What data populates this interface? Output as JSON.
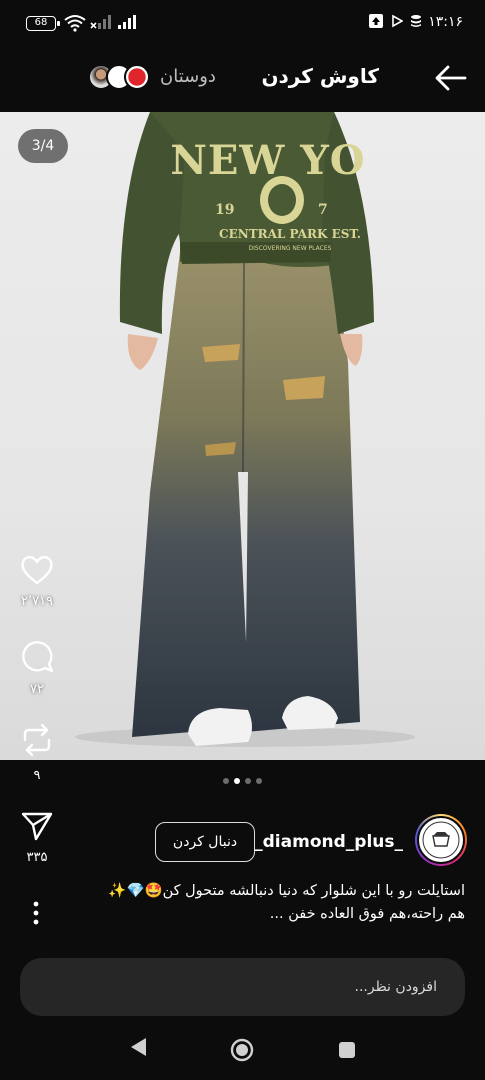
{
  "status_bar": {
    "battery": "68",
    "time": "۱۳:۱۶"
  },
  "header": {
    "title": "کاوش کردن",
    "friends_tab": "دوستان"
  },
  "post": {
    "image_counter": "3/4",
    "likes": "۲٬۷۱۹",
    "comments": "۷۲",
    "reposts": "۹",
    "shares": "۳۳۵",
    "username": "_diamond_plus_",
    "follow_label": "دنبال کردن",
    "caption_line1": "استایلت رو با این شلوار که دنیا دنبالشه متحول کن🤩💎✨",
    "caption_line2": "هم راحته،هم فوق العاده خفن ...",
    "page_dots": {
      "count": 4,
      "active": 1
    }
  },
  "comment": {
    "placeholder": "افزودن نظر..."
  },
  "colors": {
    "background": "#0c0c0c",
    "input_bg": "#262626",
    "sweater": "#4a5a34",
    "jeans": "#3d4757"
  },
  "icons": [
    "back-arrow-icon",
    "heart-icon",
    "comment-icon",
    "repost-icon",
    "send-icon",
    "more-icon",
    "wifi-icon",
    "signal-icon",
    "nav-back-icon",
    "nav-home-icon",
    "nav-recents-icon"
  ]
}
